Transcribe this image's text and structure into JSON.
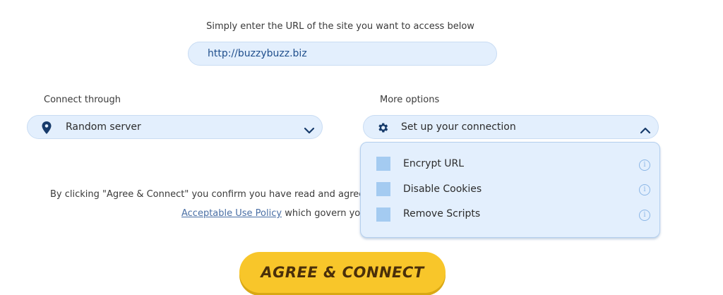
{
  "intro_text": "Simply enter the URL of the site you want to access below",
  "url_input": {
    "value": "http://buzzybuzz.biz"
  },
  "connect": {
    "label": "Connect through",
    "selected": "Random server",
    "icon": "location-pin-icon",
    "chevron": "chevron-down-icon"
  },
  "options": {
    "label": "More options",
    "selected": "Set up your connection",
    "icon": "gear-icon",
    "chevron": "chevron-up-icon",
    "items": [
      {
        "label": "Encrypt URL",
        "info": "i"
      },
      {
        "label": "Disable Cookies",
        "info": "i"
      },
      {
        "label": "Remove Scripts",
        "info": "i"
      }
    ]
  },
  "notice": {
    "line1": "By clicking \"Agree & Connect\" you confirm you have read and agree",
    "link": "Acceptable Use Policy",
    "line2_tail": " which govern yo"
  },
  "cta": {
    "label": "AGREE & CONNECT"
  },
  "colors": {
    "accent": "#f8c62a",
    "field_bg": "#e3effd",
    "checkbox": "#a4cbf1"
  }
}
